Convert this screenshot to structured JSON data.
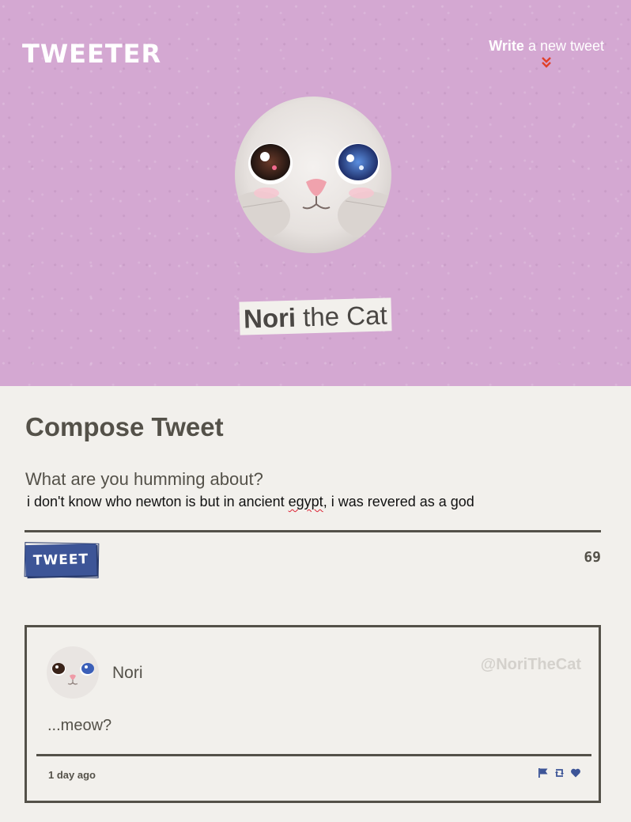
{
  "app": {
    "brand": "TWEETER",
    "accent_color": "#3d5597",
    "chevron_color": "#e0412a",
    "header_bg": "#d4a8d2"
  },
  "header": {
    "write_strong": "Write",
    "write_rest": " a new tweet",
    "profile_first": "Nori",
    "profile_rest": " the Cat",
    "chevron_icon": "double-chevron-down-icon"
  },
  "compose": {
    "title": "Compose Tweet",
    "prompt": "What are you humming about?",
    "text_before": "i don't know who newton is but in ancient ",
    "text_misspelled": "egypt",
    "text_after": ", i was revered as a god",
    "tweet_button_label": "TWEET",
    "char_count": "69"
  },
  "tweets": [
    {
      "name": "Nori",
      "handle": "@NoriTheCat",
      "content": "...meow?",
      "time": "1 day ago",
      "actions": [
        "flag-icon",
        "retweet-icon",
        "heart-icon"
      ]
    }
  ]
}
